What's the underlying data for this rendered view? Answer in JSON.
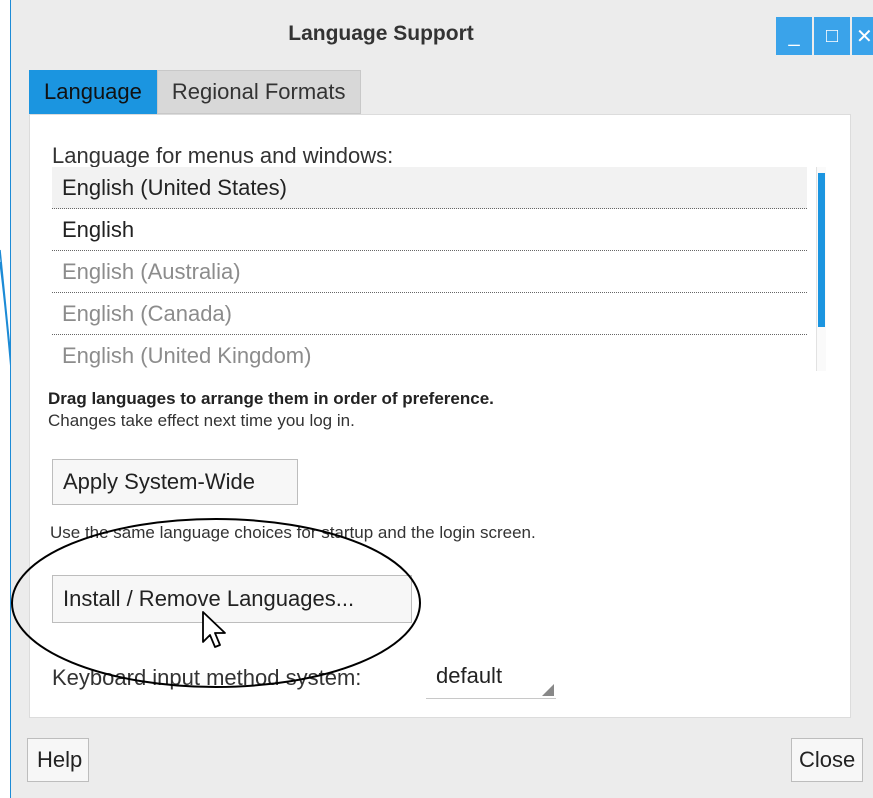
{
  "window": {
    "title": "Language Support",
    "buttons": {
      "minimize_glyph": "_",
      "maximize_glyph": "□",
      "close_glyph": "✕"
    }
  },
  "tabs": [
    {
      "label": "Language",
      "active": true
    },
    {
      "label": "Regional Formats",
      "active": false
    }
  ],
  "language_tab": {
    "menus_label": "Language for menus and windows:",
    "languages": [
      {
        "label": "English (United States)",
        "enabled": true
      },
      {
        "label": "English",
        "enabled": true
      },
      {
        "label": "English (Australia)",
        "enabled": false
      },
      {
        "label": "English (Canada)",
        "enabled": false
      },
      {
        "label": "English (United Kingdom)",
        "enabled": false
      }
    ],
    "drag_hint": "Drag languages to arrange them in order of preference.",
    "changes_hint": "Changes take effect next time you log in.",
    "apply_button": "Apply System-Wide",
    "apply_note": "Use the same language choices for startup and the login screen.",
    "install_button": "Install / Remove Languages...",
    "keyboard_label": "Keyboard input method system:",
    "keyboard_value": "default"
  },
  "footer": {
    "help_button": "Help",
    "close_button": "Close"
  },
  "colors": {
    "accent": "#1b95e0",
    "wm_button": "#3aa3ea",
    "window_bg": "#ececec"
  }
}
